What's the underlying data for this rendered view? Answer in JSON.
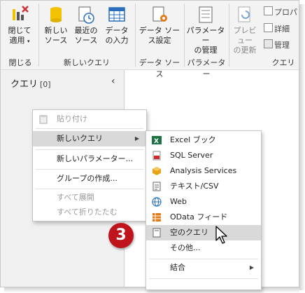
{
  "ribbon": {
    "close_apply": "閉じて\n適用",
    "new_source": "新しい\nソース",
    "recent_sources": "最近の\nソース",
    "enter_data": "データ\nの入力",
    "data_source_settings": "データ ソー\nス設定",
    "manage_parameters": "パラメーター\nの管理",
    "refresh_preview": "プレビュー\nの更新",
    "properties": "プロパ",
    "advanced_editor": "詳細",
    "manage": "管理",
    "groups": {
      "close": "閉じる",
      "new_query": "新しいクエリ",
      "data_sources": "データ ソース",
      "parameters": "パラメーター",
      "query": "クエリ"
    }
  },
  "queries_pane": {
    "title": "クエリ",
    "count": "[0]",
    "collapse_glyph": "‹"
  },
  "context_menu": {
    "paste": "貼り付け",
    "new_query": "新しいクエリ",
    "new_parameter": "新しいパラメーター...",
    "create_group": "グループの作成...",
    "expand_all": "すべて展開",
    "collapse_all": "すべて折りたたむ"
  },
  "submenu": {
    "items": [
      {
        "label": "Excel ブック",
        "icon": "excel-icon"
      },
      {
        "label": "SQL Server",
        "icon": "sql-server-icon"
      },
      {
        "label": "Analysis Services",
        "icon": "analysis-services-icon"
      },
      {
        "label": "テキスト/CSV",
        "icon": "text-csv-icon"
      },
      {
        "label": "Web",
        "icon": "web-globe-icon"
      },
      {
        "label": "OData フィード",
        "icon": "odata-icon"
      },
      {
        "label": "空のクエリ",
        "icon": "blank-query-icon",
        "highlighted": true
      },
      {
        "label": "その他...",
        "icon": ""
      }
    ],
    "combine": "結合"
  },
  "step_badge": "3",
  "colors": {
    "excel_green": "#1e7145",
    "sql_red": "#c72b2b",
    "analysis_gold": "#e8a317",
    "web_blue": "#2a6ebb",
    "odata_orange": "#e07b1a",
    "badge_red": "#c0141d",
    "highlight": "#d9d9d9"
  }
}
